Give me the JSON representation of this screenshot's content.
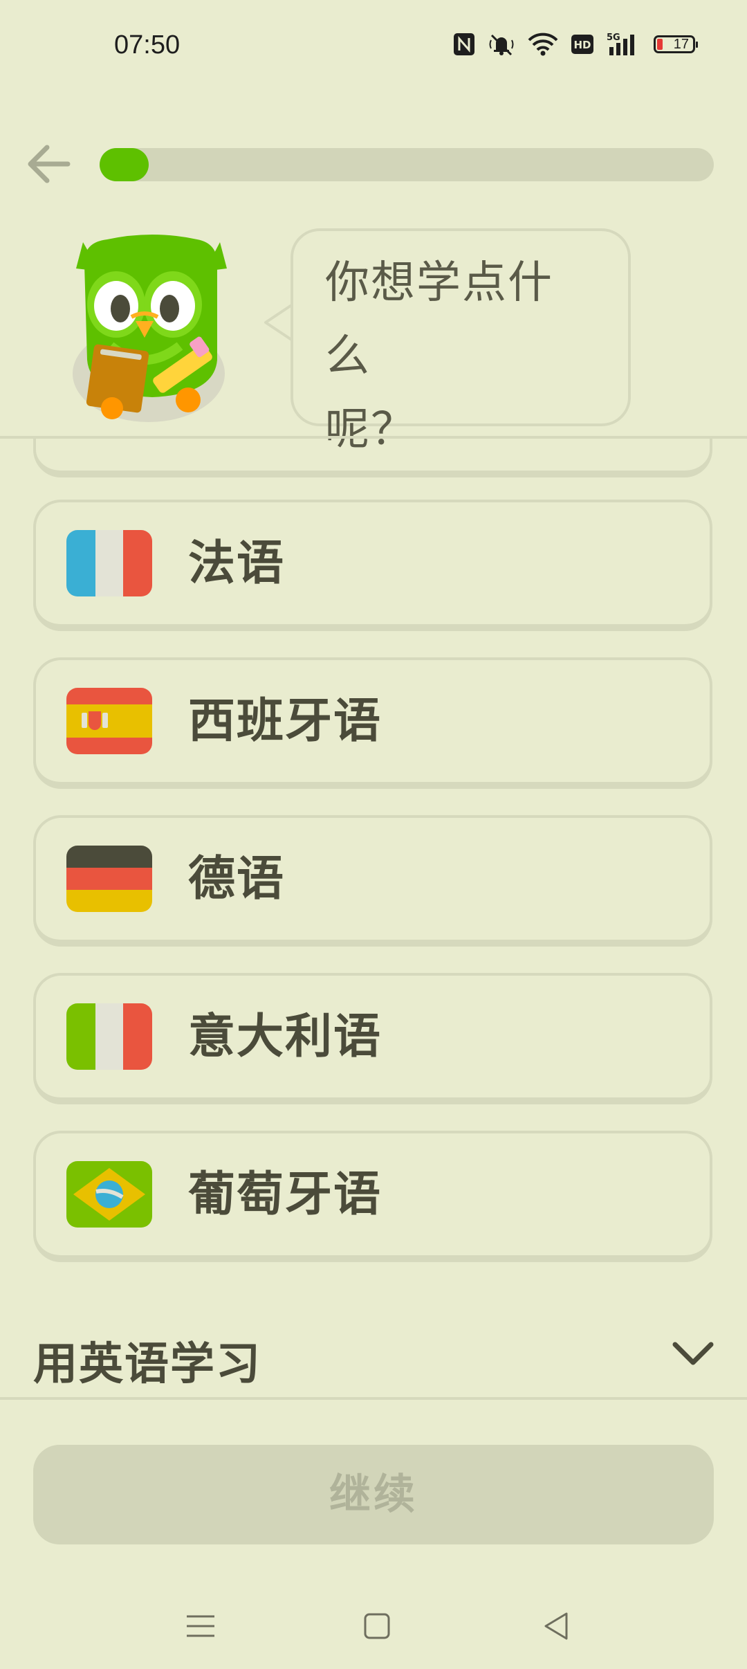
{
  "status_bar": {
    "time": "07:50",
    "battery_level": "17",
    "icons": [
      "nfc-icon",
      "mute-icon",
      "wifi-icon",
      "hd-icon",
      "5g-signal-icon",
      "battery-icon"
    ]
  },
  "progress": {
    "fraction": 0.08
  },
  "prompt": {
    "line1": "你想学点什么",
    "line2": "呢？"
  },
  "languages": [
    {
      "label": "法语",
      "flag": "france-flag-icon"
    },
    {
      "label": "西班牙语",
      "flag": "spain-flag-icon"
    },
    {
      "label": "德语",
      "flag": "germany-flag-icon"
    },
    {
      "label": "意大利语",
      "flag": "italy-flag-icon"
    },
    {
      "label": "葡萄牙语",
      "flag": "brazil-flag-icon"
    }
  ],
  "learn_in": {
    "label": "用英语学习"
  },
  "continue_button": {
    "label": "继续"
  },
  "colors": {
    "background": "#e9eccf",
    "progress": "#5ec000",
    "border": "#d6d9bd"
  }
}
